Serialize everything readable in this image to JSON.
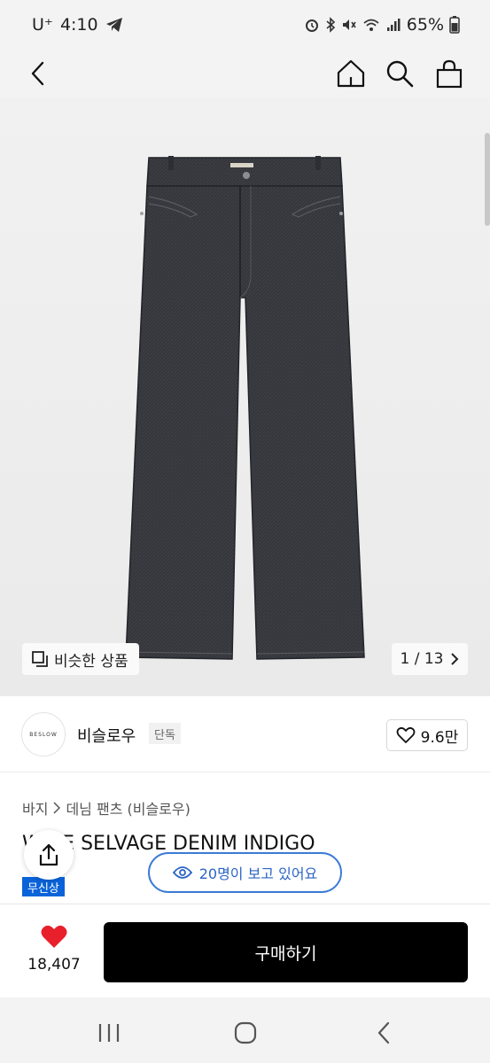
{
  "status_bar": {
    "carrier": "U⁺",
    "time": "4:10",
    "battery": "65%",
    "icons": [
      "telegram-icon",
      "alarm-icon",
      "bluetooth-icon",
      "mute-icon",
      "wifi-icon",
      "signal-icon",
      "battery-icon"
    ]
  },
  "nav": {
    "icons": [
      "back-arrow-icon",
      "home-icon",
      "search-icon",
      "shopping-bag-icon"
    ]
  },
  "gallery": {
    "similar_label": "비슷한 상품",
    "page_indicator": "1 / 13",
    "current_page": 1,
    "total_pages": 13
  },
  "brand": {
    "logo_text": "BESLOW",
    "name": "비슬로우",
    "tag": "단독",
    "likes": "9.6만"
  },
  "product": {
    "breadcrumb": [
      "바지",
      "데님 팬츠 (비슬로우)"
    ],
    "title": "WIDE SELVAGE DENIM INDIGO",
    "badge": "무신상",
    "viewing": "20명이 보고 있어요"
  },
  "purchase": {
    "wish_count": "18,407",
    "buy_label": "구매하기"
  },
  "colors": {
    "buy_button": "#000000",
    "heart": "#e8202c",
    "accent_blue": "#2a64c5",
    "badge_blue": "#0a63d8"
  }
}
